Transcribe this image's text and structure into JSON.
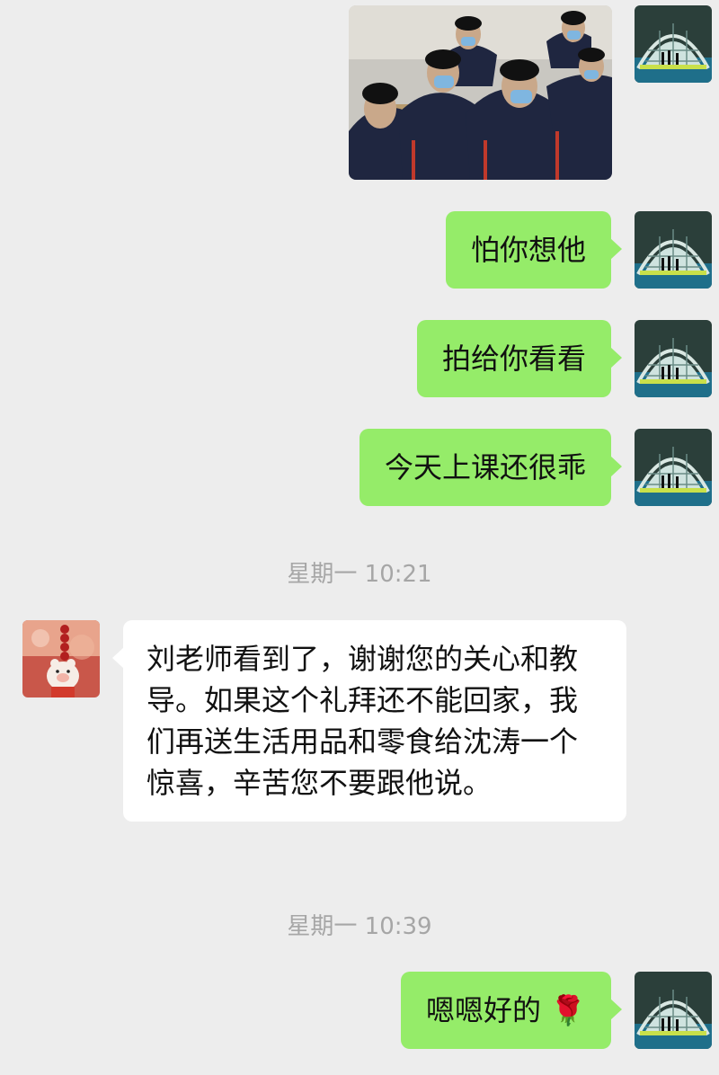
{
  "chat": {
    "timestamps": [
      "星期一 10:21",
      "星期一 10:39"
    ],
    "messages": {
      "m1": "怕你想他",
      "m2": "拍给你看看",
      "m3": "今天上课还很乖",
      "m4": "刘老师看到了，谢谢您的关心和教导。如果这个礼拜还不能回家，我们再送生活用品和零食给沈涛一个惊喜，辛苦您不要跟他说。",
      "m5_text": "嗯嗯好的",
      "m5_emoji": "🌹"
    },
    "avatars": {
      "self": "arch-window-icon",
      "other": "pig-doll-icon"
    },
    "photo": "classroom-photo"
  },
  "colors": {
    "background": "#ededed",
    "self_bubble": "#95ec69",
    "other_bubble": "#ffffff",
    "timestamp": "#a6a6a6"
  }
}
